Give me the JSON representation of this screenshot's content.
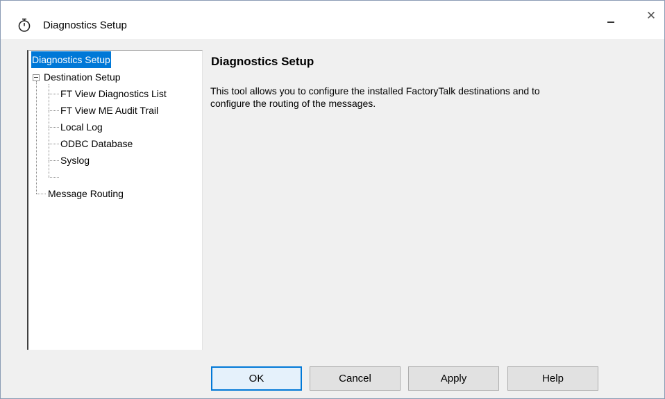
{
  "window": {
    "title": "Diagnostics Setup",
    "minimize_glyph": "–",
    "close_glyph": "✕"
  },
  "tree": {
    "items": [
      {
        "label": "Diagnostics Setup",
        "selected": true
      },
      {
        "label": "Destination Setup",
        "expanded": true
      },
      {
        "label": "FT View Diagnostics List"
      },
      {
        "label": "FT View ME Audit Trail"
      },
      {
        "label": "Local Log"
      },
      {
        "label": "ODBC Database"
      },
      {
        "label": "Syslog"
      },
      {
        "label": "Message Routing"
      }
    ]
  },
  "panel": {
    "title": "Diagnostics Setup",
    "description_line1": "This tool allows you to configure the installed FactoryTalk destinations and to",
    "description_line2": "configure the routing of the messages."
  },
  "buttons": {
    "ok": "OK",
    "cancel": "Cancel",
    "apply": "Apply",
    "help": "Help"
  },
  "colors": {
    "selection": "#0078d7",
    "window_bg": "#f0f0f0",
    "title_bg": "#ffffff"
  },
  "icons": {
    "title": "stopwatch-icon",
    "expander": "tree-collapse-icon"
  }
}
